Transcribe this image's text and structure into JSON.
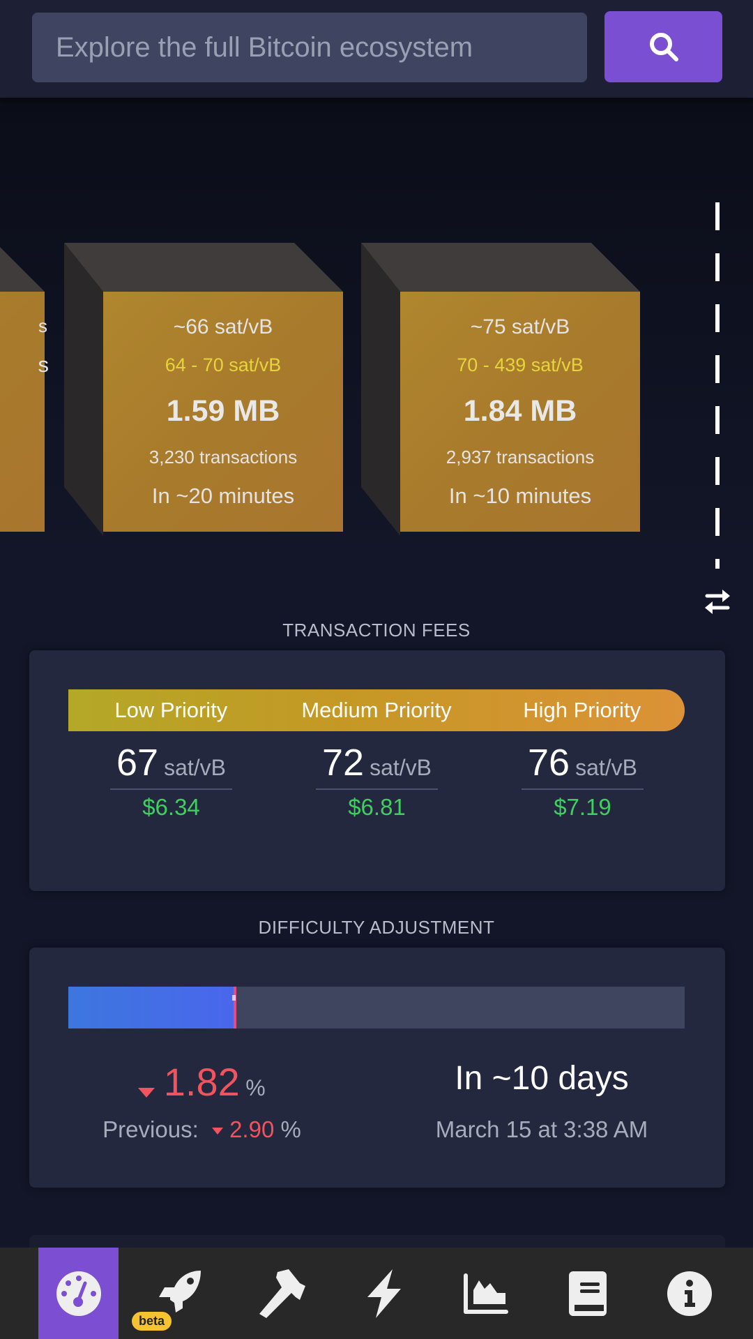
{
  "search": {
    "placeholder": "Explore the full Bitcoin ecosystem",
    "value": "",
    "button_icon": "search-icon"
  },
  "mempool_blocks": [
    {
      "median_fee": "",
      "fee_range": "",
      "size": "",
      "tx_count": "s",
      "eta": "s",
      "partial": true
    },
    {
      "median_fee": "~66 sat/vB",
      "fee_range": "64 - 70 sat/vB",
      "size": "1.59 MB",
      "tx_count": "3,230 transactions",
      "eta": "In ~20 minutes"
    },
    {
      "median_fee": "~75 sat/vB",
      "fee_range": "70 - 439 sat/vB",
      "size": "1.84 MB",
      "tx_count": "2,937 transactions",
      "eta": "In ~10 minutes"
    }
  ],
  "swap_icon": "swap-arrows-icon",
  "transaction_fees": {
    "title": "TRANSACTION FEES",
    "priorities": [
      {
        "label": "Low Priority",
        "value": "67",
        "unit": "sat/vB",
        "usd": "$6.34"
      },
      {
        "label": "Medium Priority",
        "value": "72",
        "unit": "sat/vB",
        "usd": "$6.81"
      },
      {
        "label": "High Priority",
        "value": "76",
        "unit": "sat/vB",
        "usd": "$7.19"
      }
    ]
  },
  "difficulty_adjustment": {
    "title": "DIFFICULTY ADJUSTMENT",
    "progress_percent": 27,
    "change_value": "1.82",
    "change_unit": "%",
    "change_direction": "down",
    "previous_label": "Previous:",
    "previous_value": "2.90",
    "previous_unit": "%",
    "eta": "In ~10 days",
    "eta_date": "March 15 at 3:38 AM",
    "colors": {
      "negative": "#f1545d",
      "fill": "#4a6ae8",
      "marker": "#e84c7a"
    }
  },
  "bottom_nav": {
    "items": [
      {
        "icon": "dashboard-gauge-icon",
        "active": true
      },
      {
        "icon": "rocket-icon",
        "badge": "beta"
      },
      {
        "icon": "hammer-icon"
      },
      {
        "icon": "lightning-icon"
      },
      {
        "icon": "chart-area-icon"
      },
      {
        "icon": "book-icon"
      },
      {
        "icon": "info-icon"
      }
    ],
    "accent": "#7c4fd2"
  }
}
